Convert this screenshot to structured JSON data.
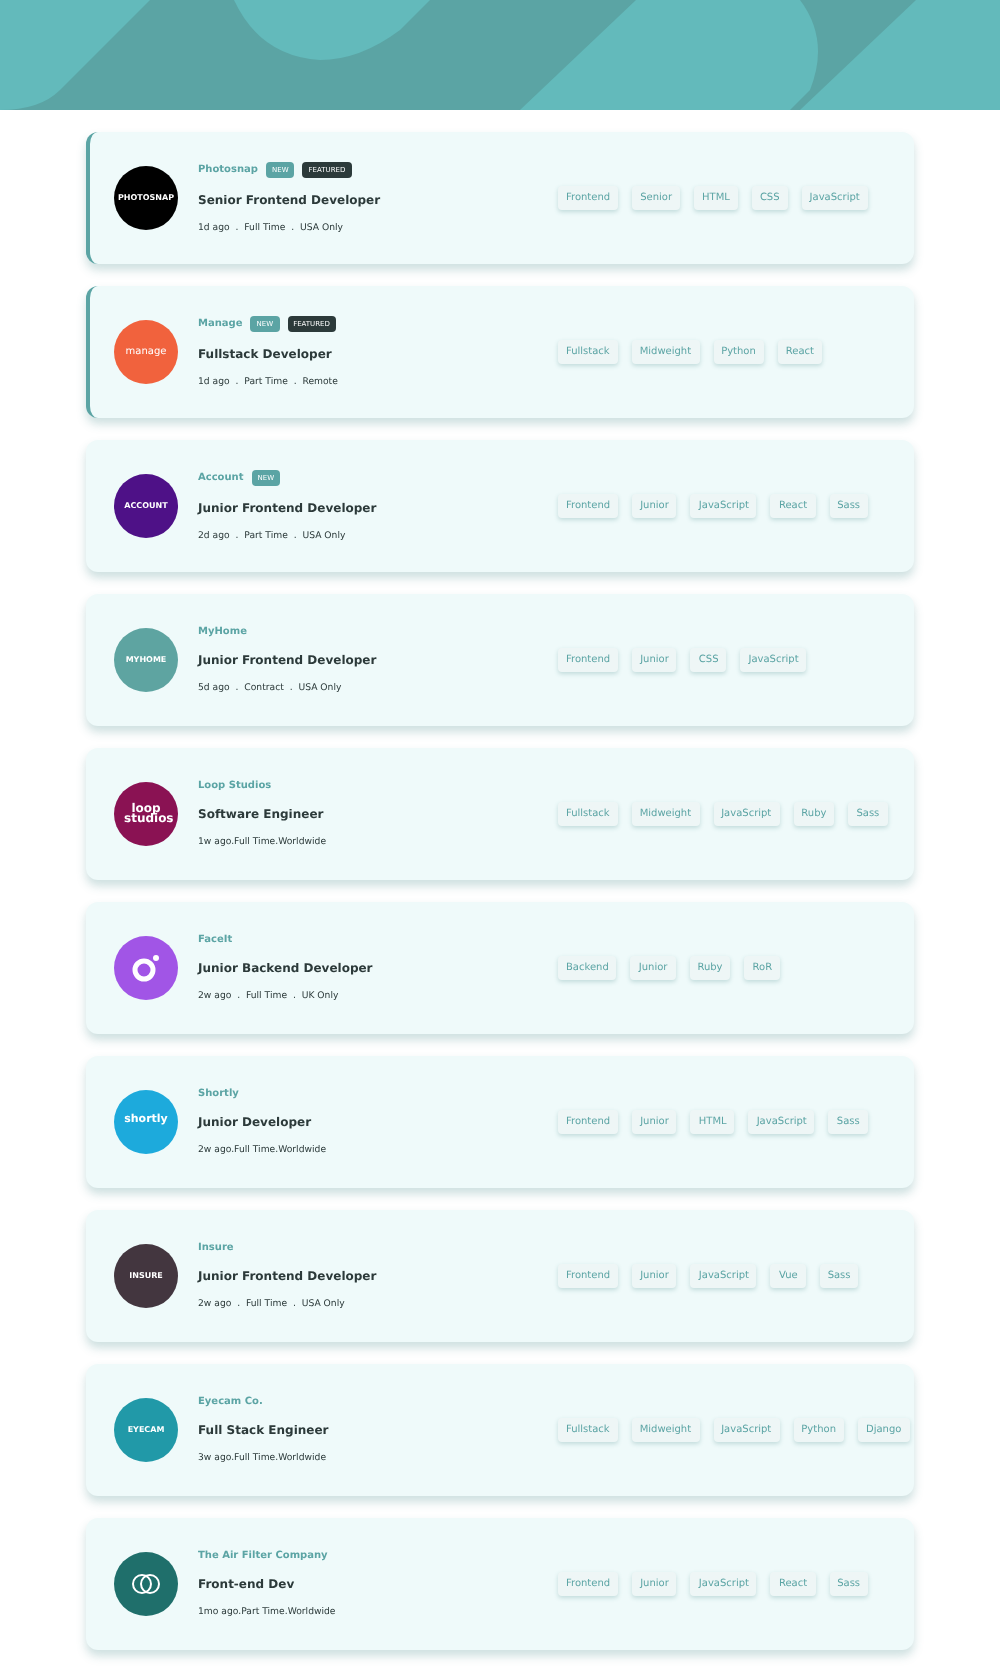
{
  "jobs": [
    {
      "company": "Photosnap",
      "highlighted": true,
      "logo": {
        "kind": "text",
        "text": "PHOTOSNAP",
        "color": "#000000"
      },
      "badges": [
        {
          "kind": "new",
          "label": "NEW"
        },
        {
          "kind": "featured",
          "label": "FEATURED"
        }
      ],
      "title": "Senior Frontend Developer",
      "meta": "1d ago  .  Full Time  .  USA Only",
      "tags": [
        "Frontend",
        "Senior",
        "HTML",
        "CSS",
        "JavaScript"
      ]
    },
    {
      "company": "Manage",
      "highlighted": true,
      "logo": {
        "kind": "text",
        "text": "manage",
        "color": "#f1623d"
      },
      "badges": [
        {
          "kind": "new",
          "label": "NEW"
        },
        {
          "kind": "featured",
          "label": "FEATURED"
        }
      ],
      "title": "Fullstack Developer",
      "meta": "1d ago  .  Part Time  .  Remote",
      "tags": [
        "Fullstack",
        "Midweight",
        "Python",
        "React"
      ]
    },
    {
      "company": "Account",
      "highlighted": false,
      "logo": {
        "kind": "text",
        "text": "ACCOUNT",
        "color": "#4e1187"
      },
      "badges": [
        {
          "kind": "new",
          "label": "NEW"
        }
      ],
      "title": "Junior Frontend Developer",
      "meta": "2d ago  .  Part Time  .  USA Only",
      "tags": [
        "Frontend",
        "Junior",
        "JavaScript",
        "React",
        "Sass"
      ]
    },
    {
      "company": "MyHome",
      "highlighted": false,
      "logo": {
        "kind": "text",
        "text": "MYHOME",
        "color": "#5ea4a1"
      },
      "title": "Junior Frontend Developer",
      "meta": "5d ago  .  Contract  .  USA Only",
      "tags": [
        "Frontend",
        "Junior",
        "CSS",
        "JavaScript"
      ]
    },
    {
      "company": "Loop Studios",
      "highlighted": false,
      "logo": {
        "kind": "text",
        "text": "loop studios",
        "color": "#8a1253"
      },
      "title": "Software Engineer",
      "meta": "1w ago.Full Time.Worldwide",
      "tags": [
        "Fullstack",
        "Midweight",
        "JavaScript",
        "Ruby",
        "Sass"
      ]
    },
    {
      "company": "FaceIt",
      "highlighted": false,
      "logo": {
        "kind": "ring",
        "color": "#a155e6"
      },
      "title": "Junior Backend Developer",
      "meta": "2w ago  .  Full Time  .  UK Only",
      "tags": [
        "Backend",
        "Junior",
        "Ruby",
        "RoR"
      ]
    },
    {
      "company": "Shortly",
      "highlighted": false,
      "logo": {
        "kind": "text",
        "text": "shortly",
        "color": "#1daadc"
      },
      "title": "Junior Developer",
      "meta": "2w ago.Full Time.Worldwide",
      "tags": [
        "Frontend",
        "Junior",
        "HTML",
        "JavaScript",
        "Sass"
      ]
    },
    {
      "company": "Insure",
      "highlighted": false,
      "logo": {
        "kind": "text",
        "text": "INSURE",
        "color": "#43363f"
      },
      "title": "Junior Frontend Developer",
      "meta": "2w ago  .  Full Time  .  USA Only",
      "tags": [
        "Frontend",
        "Junior",
        "JavaScript",
        "Vue",
        "Sass"
      ]
    },
    {
      "company": "Eyecam Co.",
      "highlighted": false,
      "logo": {
        "kind": "text",
        "text": "EYECAM",
        "color": "#2199a8"
      },
      "title": "Full Stack Engineer",
      "meta": "3w ago.Full Time.Worldwide",
      "tags": [
        "Fullstack",
        "Midweight",
        "JavaScript",
        "Python",
        "Django"
      ]
    },
    {
      "company": "The Air Filter Company",
      "highlighted": false,
      "logo": {
        "kind": "rings",
        "color": "#1f6f6b"
      },
      "title": "Front-end Dev",
      "meta": "1mo ago.Part Time.Worldwide",
      "tags": [
        "Frontend",
        "Junior",
        "JavaScript",
        "React",
        "Sass"
      ]
    }
  ]
}
